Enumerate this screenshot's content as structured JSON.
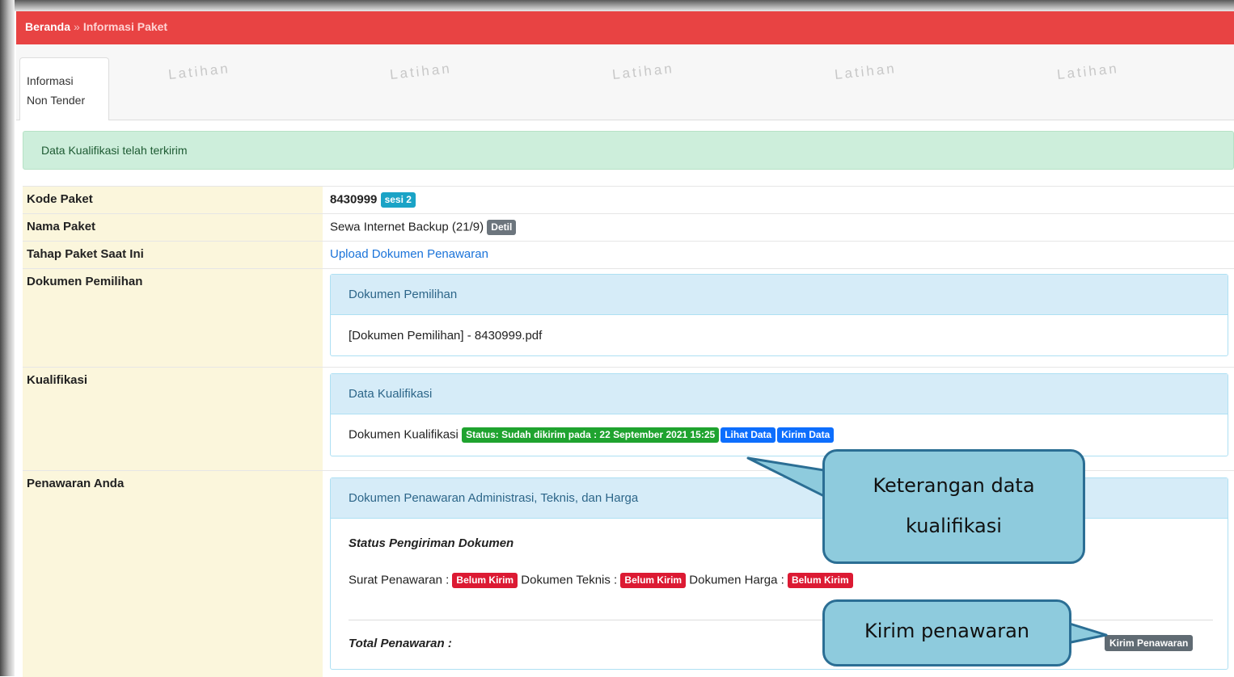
{
  "breadcrumb": {
    "home": "Beranda",
    "separator": "»",
    "current": "Informasi Paket"
  },
  "tab": {
    "label_line1": "Informasi",
    "label_line2": "Non Tender"
  },
  "watermark": "Latihan",
  "alert": "Data Kualifikasi telah terkirim",
  "fields": {
    "kode_paket": {
      "label": "Kode Paket",
      "value": "8430999",
      "badge": "sesi 2"
    },
    "nama_paket": {
      "label": "Nama Paket",
      "value": "Sewa Internet Backup (21/9)",
      "badge": "Detil"
    },
    "tahap": {
      "label": "Tahap Paket Saat Ini",
      "value": "Upload Dokumen Penawaran"
    },
    "dokumen_pemilihan": {
      "label": "Dokumen Pemilihan",
      "panel_title": "Dokumen Pemilihan",
      "file": "[Dokumen Pemilihan] - 8430999.pdf"
    },
    "kualifikasi": {
      "label": "Kualifikasi",
      "panel_title": "Data Kualifikasi",
      "doc_label": "Dokumen Kualifikasi",
      "status": "Status: Sudah dikirim pada : 22 September 2021 15:25",
      "lihat": "Lihat Data",
      "kirim": "Kirim Data"
    },
    "penawaran": {
      "label": "Penawaran Anda",
      "panel_title": "Dokumen Penawaran Administrasi, Teknis, dan Harga",
      "status_heading": "Status Pengiriman Dokumen",
      "surat_label": "Surat Penawaran :",
      "teknis_label": "Dokumen Teknis :",
      "harga_label": "Dokumen Harga :",
      "belum": "Belum Kirim",
      "total_label": "Total Penawaran :",
      "kirim_button": "Kirim Penawaran"
    }
  },
  "callouts": {
    "kualifikasi_line1": "Keterangan data",
    "kualifikasi_line2": "kualifikasi",
    "kirim": "Kirim penawaran"
  },
  "colors": {
    "header": "#e84343",
    "label_bg": "#fbf6dc",
    "panel_head": "#d6ecf8",
    "callout": "#8ecbdd"
  }
}
